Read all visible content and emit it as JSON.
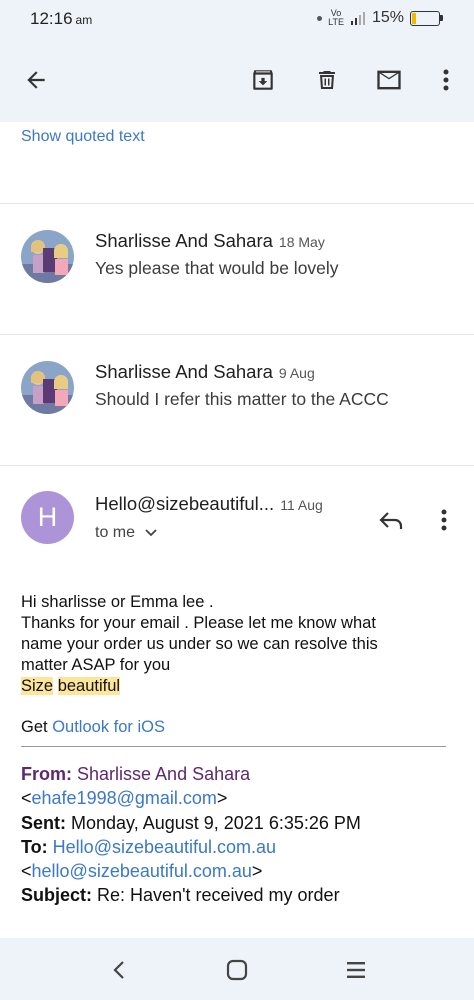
{
  "status_bar": {
    "time": "12:16",
    "ampm": "am",
    "network": "Vo LTE",
    "battery": "15%",
    "battery_level": 0.15,
    "battery_color": "#f2b900"
  },
  "toolbar": {
    "back_icon": "arrow-back-icon",
    "archive_icon": "archive-icon",
    "delete_icon": "trash-icon",
    "mail_icon": "mail-icon",
    "more_icon": "more-vert-icon"
  },
  "show_quoted": "Show quoted text",
  "thread": [
    {
      "sender": "Sharlisse And Sahara",
      "date": "18 May",
      "snippet": "Yes please that would be lovely"
    },
    {
      "sender": "Sharlisse And Sahara",
      "date": "9 Aug",
      "snippet": "Should I refer this matter to the ACCC"
    }
  ],
  "message": {
    "avatar_letter": "H",
    "avatar_color": "#ad94d8",
    "sender": "Hello@sizebeautiful...",
    "date": "11 Aug",
    "recipient": "to me",
    "body": {
      "line1": "Hi sharlisse or Emma lee .",
      "line2": "Thanks for your email . Please let me know what",
      "line3": "name your order us under so we can resolve this",
      "line4": "matter ASAP for you",
      "sig_word1": "Size",
      "sig_word2": "beautiful",
      "get": "Get",
      "outlook": "Outlook for iOS"
    },
    "quoted_header": {
      "from_label": "From:",
      "from_name": "Sharlisse And Sahara",
      "from_email": "ehafe1998@gmail.com",
      "sent_label": "Sent:",
      "sent_value": "Monday, August 9, 2021 6:35:26 PM",
      "to_label": "To:",
      "to_value": "Hello@sizebeautiful.com.au",
      "to_email": "hello@sizebeautiful.com.au",
      "subject_label": "Subject:",
      "subject_value": "Re: Haven't received my order"
    }
  },
  "nav_bar": {
    "back": "nav-back-icon",
    "home": "nav-home-icon",
    "recents": "nav-recents-icon"
  }
}
